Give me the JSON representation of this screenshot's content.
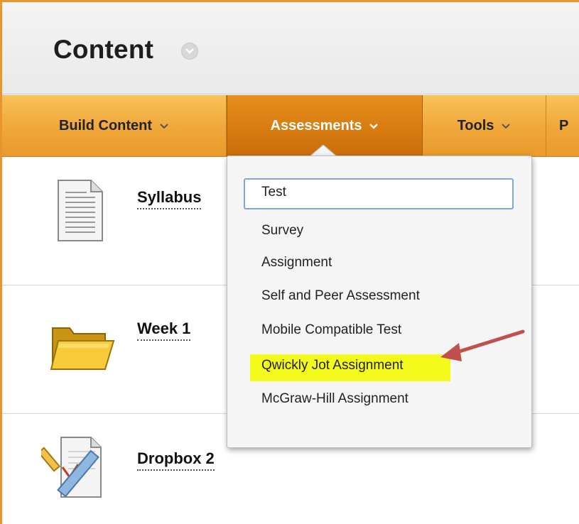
{
  "header": {
    "title": "Content",
    "title_options_icon": "chevron-down-icon"
  },
  "toolbar": {
    "buttons": [
      {
        "label": "Build Content",
        "icon": "chevron-down-icon",
        "active": false
      },
      {
        "label": "Assessments",
        "icon": "chevron-down-icon",
        "active": true
      },
      {
        "label": "Tools",
        "icon": "chevron-down-icon",
        "active": false
      },
      {
        "label": "P",
        "icon": "",
        "active": false
      }
    ],
    "accent_color": "#f1a93b",
    "active_color": "#d77a10"
  },
  "content_items": [
    {
      "title": "Syllabus",
      "icon": "document-icon"
    },
    {
      "title": "Week 1",
      "icon": "folder-icon"
    },
    {
      "title": "Dropbox 2",
      "icon": "assignment-icon"
    }
  ],
  "assessments_menu": {
    "items": [
      {
        "label": "Test",
        "focused": true
      },
      {
        "label": "Survey"
      },
      {
        "label": "Assignment"
      },
      {
        "label": "Self and Peer Assessment"
      },
      {
        "label": "Mobile Compatible Test"
      },
      {
        "label": "Qwickly Jot Assignment",
        "highlighted": true
      },
      {
        "label": "McGraw-Hill Assignment"
      }
    ],
    "highlight_color": "#f4f91c",
    "annotation_arrow_color": "#c0504d"
  }
}
